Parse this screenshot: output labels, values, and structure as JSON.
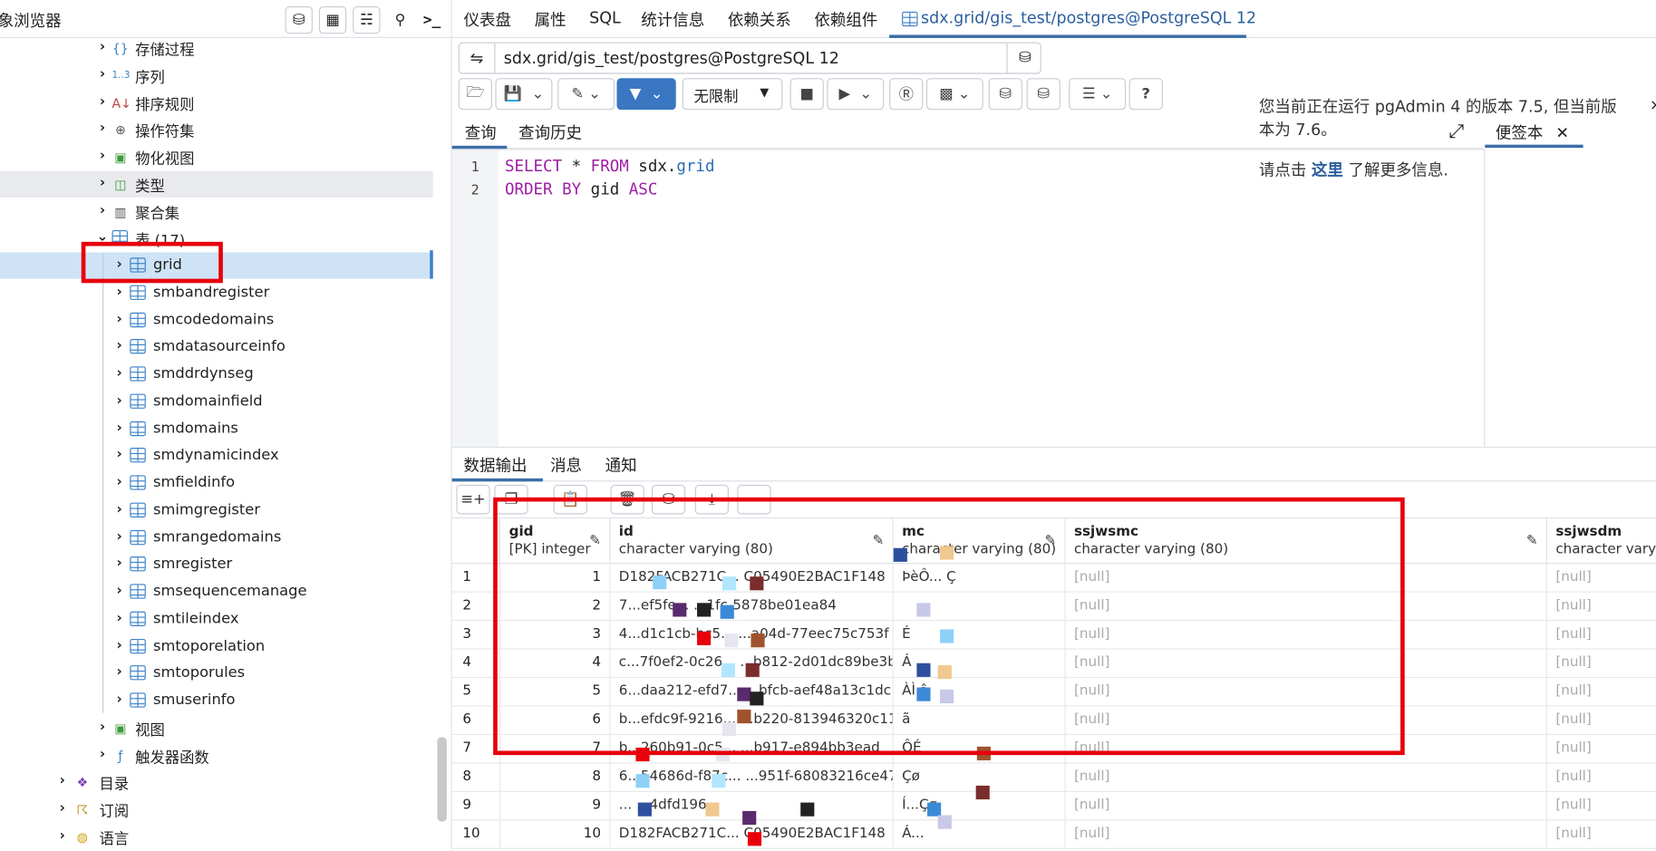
{
  "browser": {
    "title": "象浏览器",
    "tree": [
      {
        "label": "存储过程",
        "icon": "procedure-icon"
      },
      {
        "label": "序列",
        "icon": "sequence-icon"
      },
      {
        "label": "排序规则",
        "icon": "collation-icon"
      },
      {
        "label": "操作符集",
        "icon": "operator-icon"
      },
      {
        "label": "物化视图",
        "icon": "mview-icon"
      },
      {
        "label": "类型",
        "icon": "type-icon"
      },
      {
        "label": "聚合集",
        "icon": "aggregate-icon"
      },
      {
        "label": "表 (17)",
        "icon": "table-group-icon"
      },
      {
        "label": "grid"
      },
      {
        "label": "smbandregister"
      },
      {
        "label": "smcodedomains"
      },
      {
        "label": "smdatasourceinfo"
      },
      {
        "label": "smddrdynseg"
      },
      {
        "label": "smdomainfield"
      },
      {
        "label": "smdomains"
      },
      {
        "label": "smdynamicindex"
      },
      {
        "label": "smfieldinfo"
      },
      {
        "label": "smimgregister"
      },
      {
        "label": "smrangedomains"
      },
      {
        "label": "smregister"
      },
      {
        "label": "smsequencemanage"
      },
      {
        "label": "smtileindex"
      },
      {
        "label": "smtoporelation"
      },
      {
        "label": "smtoporules"
      },
      {
        "label": "smuserinfo"
      },
      {
        "label": "视图"
      },
      {
        "label": "触发器函数"
      },
      {
        "label": "目录"
      },
      {
        "label": "订阅"
      },
      {
        "label": "语言"
      }
    ]
  },
  "nav": {
    "tabs": [
      "仪表盘",
      "属性",
      "SQL",
      "统计信息",
      "依赖关系",
      "依赖组件"
    ],
    "active_tab": "sdx.grid/gis_test/postgres@PostgreSQL 12"
  },
  "query_tool": {
    "connection": "sdx.grid/gis_test/postgres@PostgreSQL 12",
    "limit": "无限制",
    "tabs": [
      "查询",
      "查询历史"
    ],
    "scratch_label": "便签本",
    "notice_line1": "您当前正在运行 pgAdmin 4 的版本 7.5, 但当前版本为 7.6。",
    "notice_pre": "请点击",
    "notice_link": "这里",
    "notice_post": "了解更多信息.",
    "lines": [
      "1",
      "2"
    ],
    "sql": {
      "kw1": "SELECT",
      "star": " * ",
      "kw2": "FROM",
      "schema": " sdx.",
      "table": "grid",
      "kw3": "ORDER BY",
      "col": " gid ",
      "kw4": "ASC"
    }
  },
  "output": {
    "tabs": [
      "数据输出",
      "消息",
      "通知"
    ],
    "columns": [
      {
        "name": "gid",
        "type": "[PK] integer"
      },
      {
        "name": "id",
        "type": "character varying (80)"
      },
      {
        "name": "mc",
        "type": "character varying (80)"
      },
      {
        "name": "ssjwsmc",
        "type": "character varying (80)"
      },
      {
        "name": "ssjwsdm",
        "type": "character varying"
      }
    ],
    "rows": [
      {
        "n": "1",
        "gid": "1",
        "id": "D182FACB271C... C05490E2BAC1F148",
        "mc": "ÞèÔ... Ç",
        "a": "[null]",
        "b": "[null]"
      },
      {
        "n": "2",
        "gid": "2",
        "id": "7...ef5fe... ...1fc-5878be01ea84",
        "mc": "",
        "a": "[null]",
        "b": "[null]"
      },
      {
        "n": "3",
        "gid": "3",
        "id": "4...d1c1cb-bc5... ...a04d-77eec75c753f",
        "mc": "É",
        "a": "[null]",
        "b": "[null]"
      },
      {
        "n": "4",
        "gid": "4",
        "id": "c...7f0ef2-0c26... ...b812-2d01dc89be3b",
        "mc": "Á",
        "a": "[null]",
        "b": "[null]"
      },
      {
        "n": "5",
        "gid": "5",
        "id": "6...daa212-efd7... ...bfcb-aef48a13c1dc",
        "mc": "ÀÌ â",
        "a": "[null]",
        "b": "[null]"
      },
      {
        "n": "6",
        "gid": "6",
        "id": "b...efdc9f-9216... ...b220-813946320c11",
        "mc": "ã",
        "a": "[null]",
        "b": "[null]"
      },
      {
        "n": "7",
        "gid": "7",
        "id": "b...260b91-0c5... ...b917-e894bb3ead",
        "mc": "ÔÉ",
        "a": "[null]",
        "b": "[null]"
      },
      {
        "n": "8",
        "gid": "8",
        "id": "6...54686d-f87c... ...951f-68083216ce47",
        "mc": "Çø",
        "a": "[null]",
        "b": "[null]"
      },
      {
        "n": "9",
        "gid": "9",
        "id": "... ...4dfd196",
        "mc": "Í...Çø",
        "a": "[null]",
        "b": "[null]"
      },
      {
        "n": "10",
        "gid": "10",
        "id": "D182FACB271C... C05490E2BAC1F148",
        "mc": "Á...",
        "a": "[null]",
        "b": "[null]"
      }
    ]
  },
  "colors": {
    "accent": "#3b76c2",
    "highlight_box": "#e8000b",
    "selected_row": "#cfe3f7"
  }
}
